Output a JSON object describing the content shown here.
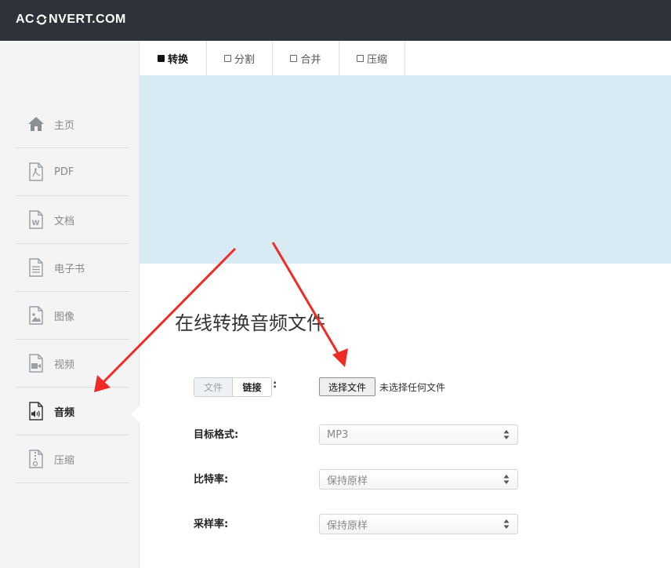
{
  "header": {
    "logo_left": "AC",
    "logo_right": "NVERT.COM"
  },
  "sidebar": {
    "items": [
      {
        "label": "主页",
        "icon": "home-icon"
      },
      {
        "label": "PDF",
        "icon": "pdf-file-icon"
      },
      {
        "label": "文档",
        "icon": "word-file-icon"
      },
      {
        "label": "电子书",
        "icon": "ebook-file-icon"
      },
      {
        "label": "图像",
        "icon": "image-file-icon"
      },
      {
        "label": "视频",
        "icon": "video-file-icon"
      },
      {
        "label": "音频",
        "icon": "audio-file-icon",
        "active": true
      },
      {
        "label": "压缩",
        "icon": "archive-file-icon"
      }
    ]
  },
  "tabs": [
    {
      "label": "转换",
      "active": true
    },
    {
      "label": "分割"
    },
    {
      "label": "合并"
    },
    {
      "label": "压缩"
    }
  ],
  "main": {
    "title": "在线转换音频文件",
    "source_toggle": {
      "file": "文件",
      "link": "链接",
      "colon": ":"
    },
    "file_input": {
      "button": "选择文件",
      "status": "未选择任何文件"
    },
    "fields": [
      {
        "label": "目标格式:",
        "value": "MP3"
      },
      {
        "label": "比特率:",
        "value": "保持原样"
      },
      {
        "label": "采样率:",
        "value": "保持原样"
      }
    ]
  },
  "colors": {
    "topbar": "#2d3339",
    "sidebar": "#f4f4f4",
    "banner": "#d8ebf5",
    "annotation_arrow": "#ee2b24"
  }
}
